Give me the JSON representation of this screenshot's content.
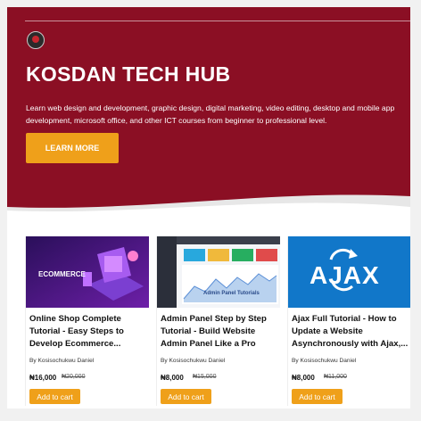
{
  "hero": {
    "logo_icon": "kosdan-logo-icon",
    "title": "KOSDAN TECH HUB",
    "description": "Learn web design and development, graphic design, digital marketing, video editing, desktop and mobile app development, microsoft office, and other ICT courses from beginner to professional level.",
    "cta_label": "LEARN MORE"
  },
  "colors": {
    "hero_background": "#8b0f24",
    "accent": "#efa01a",
    "ajax_blue": "#1177c9"
  },
  "courses": [
    {
      "thumb_label": "ECOMMERCE",
      "title": "Online Shop Complete Tutorial - Easy Steps to Develop Ecommerce...",
      "author": "By Kosisochukwu Daniel",
      "price": "₦16,000",
      "old_price": "₦20,000",
      "cart_label": "Add to cart"
    },
    {
      "thumb_label": "Admin Panel Tutorials",
      "title": "Admin Panel Step by Step Tutorial - Build Website Admin Panel Like a Pro",
      "author": "By Kosisochukwu Daniel",
      "price": "₦8,000",
      "old_price": "₦15,000",
      "cart_label": "Add to cart"
    },
    {
      "thumb_label": "AJAX",
      "title": "Ajax Full Tutorial - How to Update a Website Asynchronously with Ajax,...",
      "author": "By Kosisochukwu Daniel",
      "price": "₦8,000",
      "old_price": "₦11,000",
      "cart_label": "Add to cart"
    }
  ]
}
